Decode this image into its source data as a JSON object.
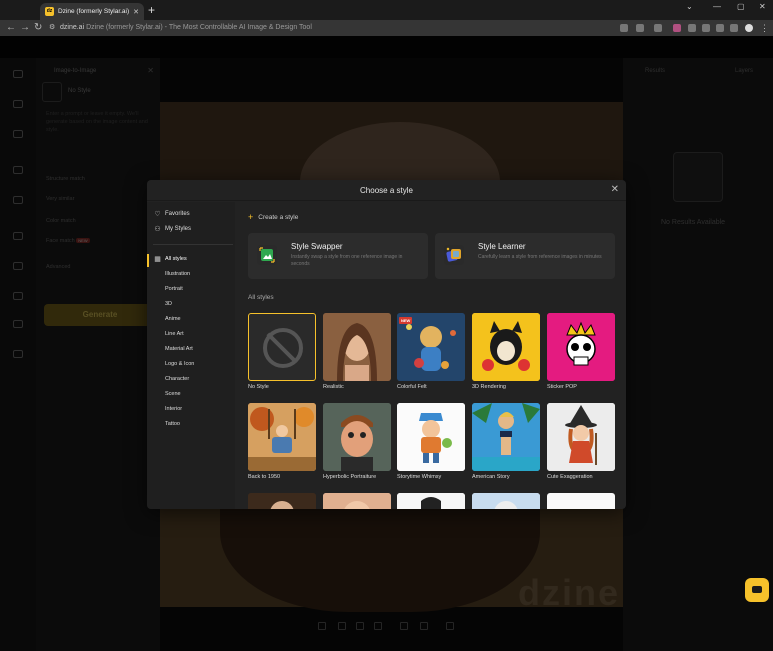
{
  "browser": {
    "tab_title": "Dzine (formerly Stylar.ai) - The",
    "favicon_text": "dz",
    "url_domain": "dzine.ai",
    "url_rest": "Dzine (formerly Stylar.ai) - The Most Controllable AI Image & Design Tool"
  },
  "left_panel": {
    "title": "Image-to-Image",
    "style_label": "No Style",
    "prompt_placeholder": "Enter a prompt or leave it empty. We'll generate based on the image content and style.",
    "structure_match_label": "Structure match",
    "very_similar_label": "Very similar",
    "color_match_label": "Color match",
    "face_match_label": "Face match",
    "face_match_badge": "NEW",
    "advanced_label": "Advanced",
    "generate_label": "Generate"
  },
  "right_panel": {
    "results_tab": "Results",
    "layers_tab": "Layers",
    "empty_text": "No Results Available"
  },
  "canvas": {
    "watermark": "dzine"
  },
  "modal": {
    "title": "Choose a style",
    "sidebar": {
      "favorites": "Favorites",
      "my_styles": "My Styles",
      "all_styles": "All styles",
      "categories": [
        "Illustration",
        "Portrait",
        "3D",
        "Anime",
        "Line Art",
        "Material Art",
        "Logo & Icon",
        "Character",
        "Scene",
        "Interior",
        "Tattoo"
      ]
    },
    "create_style": "Create a style",
    "features": [
      {
        "title": "Style Swapper",
        "desc": "Instantly swap a style from one reference image in seconds"
      },
      {
        "title": "Style Learner",
        "desc": "Carefully learn a style from reference images in minutes"
      }
    ],
    "section_label": "All styles",
    "new_badge": "NEW",
    "styles": [
      {
        "label": "No Style",
        "selected": true
      },
      {
        "label": "Realistic"
      },
      {
        "label": "Colorful Felt",
        "badge": "NEW"
      },
      {
        "label": "3D Rendering"
      },
      {
        "label": "Sticker POP"
      },
      {
        "label": "Back to 1950"
      },
      {
        "label": "Hyperbolic Portraiture"
      },
      {
        "label": "Storytime Whimsy"
      },
      {
        "label": "American Story"
      },
      {
        "label": "Cute Exaggeration"
      }
    ],
    "accent_color": "#f6c12b"
  }
}
